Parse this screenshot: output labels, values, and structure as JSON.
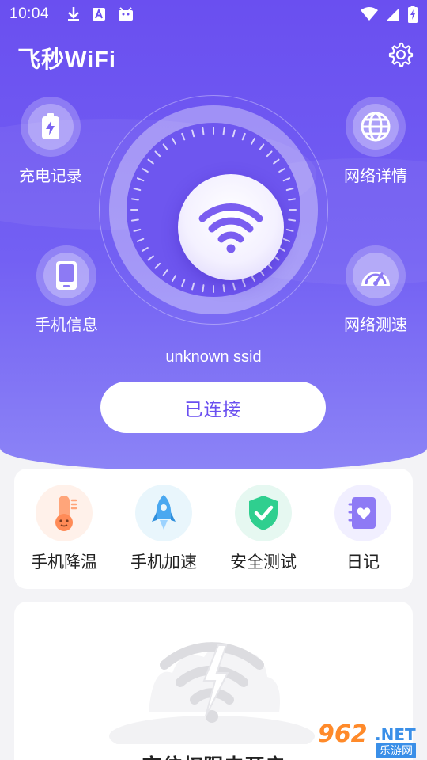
{
  "status_bar": {
    "time": "10:04",
    "left_icons": [
      "download-icon",
      "font-a-icon",
      "android-icon"
    ],
    "right_icons": [
      "wifi-signal-icon",
      "cell-signal-icon",
      "battery-icon"
    ]
  },
  "header": {
    "app_title": "飞秒WiFi",
    "settings_icon": "gear-icon"
  },
  "features": {
    "charge_record": {
      "label": "充电记录",
      "icon": "battery-charge-icon"
    },
    "network_detail": {
      "label": "网络详情",
      "icon": "globe-icon"
    },
    "phone_info": {
      "label": "手机信息",
      "icon": "phone-icon"
    },
    "network_speed": {
      "label": "网络测速",
      "icon": "speedometer-icon"
    }
  },
  "dial": {
    "icon": "wifi-icon",
    "ssid": "unknown ssid",
    "connect_label": "已连接"
  },
  "tools": [
    {
      "label": "手机降温",
      "icon": "thermometer-icon",
      "color": "#fff1ea"
    },
    {
      "label": "手机加速",
      "icon": "rocket-icon",
      "color": "#e9f6fc"
    },
    {
      "label": "安全测试",
      "icon": "shield-check-icon",
      "color": "#e6f8f1"
    },
    {
      "label": "日记",
      "icon": "diary-icon",
      "color": "#f1efff"
    }
  ],
  "empty_state": {
    "icon": "wifi-broken-icon",
    "text": "定位权限未开启"
  },
  "watermark": {
    "main": "962",
    "net": ".NET",
    "sub": "乐游网"
  },
  "colors": {
    "primary": "#6a4ff0",
    "hero_bottom": "#8c84f6"
  }
}
